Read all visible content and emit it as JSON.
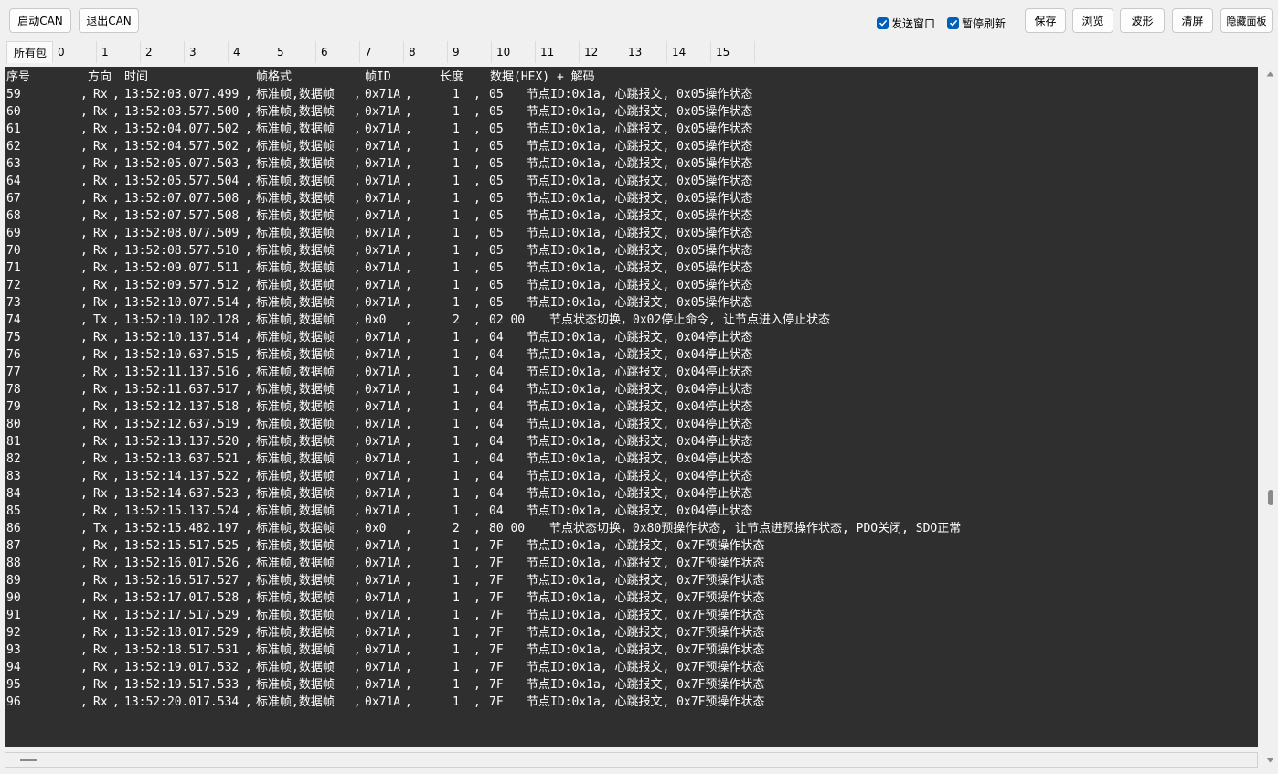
{
  "toolbar": {
    "start_can": "启动CAN",
    "exit_can": "退出CAN",
    "send_window": "发送窗口",
    "pause_refresh": "暂停刷新",
    "save": "保存",
    "browse": "浏览",
    "waveform": "波形",
    "clear": "清屏",
    "hide_panel": "隐藏面板"
  },
  "tabs": [
    "所有包",
    "0",
    "1",
    "2",
    "3",
    "4",
    "5",
    "6",
    "7",
    "8",
    "9",
    "10",
    "11",
    "12",
    "13",
    "14",
    "15"
  ],
  "console": {
    "header": {
      "seq": "序号",
      "dir": "方向",
      "time": "时间",
      "format": "帧格式",
      "id": "帧ID",
      "len": "长度",
      "data": "数据(HEX) + 解码"
    },
    "rows": [
      {
        "seq": "59",
        "dir": "Rx",
        "time": "13:52:03.077.499",
        "format": "标准帧,数据帧",
        "id": "0x71A",
        "len": "1",
        "data": "05",
        "decode": "节点ID:0x1a, 心跳报文, 0x05操作状态"
      },
      {
        "seq": "60",
        "dir": "Rx",
        "time": "13:52:03.577.500",
        "format": "标准帧,数据帧",
        "id": "0x71A",
        "len": "1",
        "data": "05",
        "decode": "节点ID:0x1a, 心跳报文, 0x05操作状态"
      },
      {
        "seq": "61",
        "dir": "Rx",
        "time": "13:52:04.077.502",
        "format": "标准帧,数据帧",
        "id": "0x71A",
        "len": "1",
        "data": "05",
        "decode": "节点ID:0x1a, 心跳报文, 0x05操作状态"
      },
      {
        "seq": "62",
        "dir": "Rx",
        "time": "13:52:04.577.502",
        "format": "标准帧,数据帧",
        "id": "0x71A",
        "len": "1",
        "data": "05",
        "decode": "节点ID:0x1a, 心跳报文, 0x05操作状态"
      },
      {
        "seq": "63",
        "dir": "Rx",
        "time": "13:52:05.077.503",
        "format": "标准帧,数据帧",
        "id": "0x71A",
        "len": "1",
        "data": "05",
        "decode": "节点ID:0x1a, 心跳报文, 0x05操作状态"
      },
      {
        "seq": "64",
        "dir": "Rx",
        "time": "13:52:05.577.504",
        "format": "标准帧,数据帧",
        "id": "0x71A",
        "len": "1",
        "data": "05",
        "decode": "节点ID:0x1a, 心跳报文, 0x05操作状态"
      },
      {
        "seq": "67",
        "dir": "Rx",
        "time": "13:52:07.077.508",
        "format": "标准帧,数据帧",
        "id": "0x71A",
        "len": "1",
        "data": "05",
        "decode": "节点ID:0x1a, 心跳报文, 0x05操作状态"
      },
      {
        "seq": "68",
        "dir": "Rx",
        "time": "13:52:07.577.508",
        "format": "标准帧,数据帧",
        "id": "0x71A",
        "len": "1",
        "data": "05",
        "decode": "节点ID:0x1a, 心跳报文, 0x05操作状态"
      },
      {
        "seq": "69",
        "dir": "Rx",
        "time": "13:52:08.077.509",
        "format": "标准帧,数据帧",
        "id": "0x71A",
        "len": "1",
        "data": "05",
        "decode": "节点ID:0x1a, 心跳报文, 0x05操作状态"
      },
      {
        "seq": "70",
        "dir": "Rx",
        "time": "13:52:08.577.510",
        "format": "标准帧,数据帧",
        "id": "0x71A",
        "len": "1",
        "data": "05",
        "decode": "节点ID:0x1a, 心跳报文, 0x05操作状态"
      },
      {
        "seq": "71",
        "dir": "Rx",
        "time": "13:52:09.077.511",
        "format": "标准帧,数据帧",
        "id": "0x71A",
        "len": "1",
        "data": "05",
        "decode": "节点ID:0x1a, 心跳报文, 0x05操作状态"
      },
      {
        "seq": "72",
        "dir": "Rx",
        "time": "13:52:09.577.512",
        "format": "标准帧,数据帧",
        "id": "0x71A",
        "len": "1",
        "data": "05",
        "decode": "节点ID:0x1a, 心跳报文, 0x05操作状态"
      },
      {
        "seq": "73",
        "dir": "Rx",
        "time": "13:52:10.077.514",
        "format": "标准帧,数据帧",
        "id": "0x71A",
        "len": "1",
        "data": "05",
        "decode": "节点ID:0x1a, 心跳报文, 0x05操作状态"
      },
      {
        "seq": "74",
        "dir": "Tx",
        "time": "13:52:10.102.128",
        "format": "标准帧,数据帧",
        "id": "0x0",
        "len": "2",
        "data": "02 00",
        "decode": "节点状态切换，0x02停止命令, 让节点进入停止状态"
      },
      {
        "seq": "75",
        "dir": "Rx",
        "time": "13:52:10.137.514",
        "format": "标准帧,数据帧",
        "id": "0x71A",
        "len": "1",
        "data": "04",
        "decode": "节点ID:0x1a, 心跳报文, 0x04停止状态"
      },
      {
        "seq": "76",
        "dir": "Rx",
        "time": "13:52:10.637.515",
        "format": "标准帧,数据帧",
        "id": "0x71A",
        "len": "1",
        "data": "04",
        "decode": "节点ID:0x1a, 心跳报文, 0x04停止状态"
      },
      {
        "seq": "77",
        "dir": "Rx",
        "time": "13:52:11.137.516",
        "format": "标准帧,数据帧",
        "id": "0x71A",
        "len": "1",
        "data": "04",
        "decode": "节点ID:0x1a, 心跳报文, 0x04停止状态"
      },
      {
        "seq": "78",
        "dir": "Rx",
        "time": "13:52:11.637.517",
        "format": "标准帧,数据帧",
        "id": "0x71A",
        "len": "1",
        "data": "04",
        "decode": "节点ID:0x1a, 心跳报文, 0x04停止状态"
      },
      {
        "seq": "79",
        "dir": "Rx",
        "time": "13:52:12.137.518",
        "format": "标准帧,数据帧",
        "id": "0x71A",
        "len": "1",
        "data": "04",
        "decode": "节点ID:0x1a, 心跳报文, 0x04停止状态"
      },
      {
        "seq": "80",
        "dir": "Rx",
        "time": "13:52:12.637.519",
        "format": "标准帧,数据帧",
        "id": "0x71A",
        "len": "1",
        "data": "04",
        "decode": "节点ID:0x1a, 心跳报文, 0x04停止状态"
      },
      {
        "seq": "81",
        "dir": "Rx",
        "time": "13:52:13.137.520",
        "format": "标准帧,数据帧",
        "id": "0x71A",
        "len": "1",
        "data": "04",
        "decode": "节点ID:0x1a, 心跳报文, 0x04停止状态"
      },
      {
        "seq": "82",
        "dir": "Rx",
        "time": "13:52:13.637.521",
        "format": "标准帧,数据帧",
        "id": "0x71A",
        "len": "1",
        "data": "04",
        "decode": "节点ID:0x1a, 心跳报文, 0x04停止状态"
      },
      {
        "seq": "83",
        "dir": "Rx",
        "time": "13:52:14.137.522",
        "format": "标准帧,数据帧",
        "id": "0x71A",
        "len": "1",
        "data": "04",
        "decode": "节点ID:0x1a, 心跳报文, 0x04停止状态"
      },
      {
        "seq": "84",
        "dir": "Rx",
        "time": "13:52:14.637.523",
        "format": "标准帧,数据帧",
        "id": "0x71A",
        "len": "1",
        "data": "04",
        "decode": "节点ID:0x1a, 心跳报文, 0x04停止状态"
      },
      {
        "seq": "85",
        "dir": "Rx",
        "time": "13:52:15.137.524",
        "format": "标准帧,数据帧",
        "id": "0x71A",
        "len": "1",
        "data": "04",
        "decode": "节点ID:0x1a, 心跳报文, 0x04停止状态"
      },
      {
        "seq": "86",
        "dir": "Tx",
        "time": "13:52:15.482.197",
        "format": "标准帧,数据帧",
        "id": "0x0",
        "len": "2",
        "data": "80 00",
        "decode": "节点状态切换，0x80预操作状态, 让节点进预操作状态, PDO关闭, SDO正常"
      },
      {
        "seq": "87",
        "dir": "Rx",
        "time": "13:52:15.517.525",
        "format": "标准帧,数据帧",
        "id": "0x71A",
        "len": "1",
        "data": "7F",
        "decode": "节点ID:0x1a, 心跳报文, 0x7F预操作状态"
      },
      {
        "seq": "88",
        "dir": "Rx",
        "time": "13:52:16.017.526",
        "format": "标准帧,数据帧",
        "id": "0x71A",
        "len": "1",
        "data": "7F",
        "decode": "节点ID:0x1a, 心跳报文, 0x7F预操作状态"
      },
      {
        "seq": "89",
        "dir": "Rx",
        "time": "13:52:16.517.527",
        "format": "标准帧,数据帧",
        "id": "0x71A",
        "len": "1",
        "data": "7F",
        "decode": "节点ID:0x1a, 心跳报文, 0x7F预操作状态"
      },
      {
        "seq": "90",
        "dir": "Rx",
        "time": "13:52:17.017.528",
        "format": "标准帧,数据帧",
        "id": "0x71A",
        "len": "1",
        "data": "7F",
        "decode": "节点ID:0x1a, 心跳报文, 0x7F预操作状态"
      },
      {
        "seq": "91",
        "dir": "Rx",
        "time": "13:52:17.517.529",
        "format": "标准帧,数据帧",
        "id": "0x71A",
        "len": "1",
        "data": "7F",
        "decode": "节点ID:0x1a, 心跳报文, 0x7F预操作状态"
      },
      {
        "seq": "92",
        "dir": "Rx",
        "time": "13:52:18.017.529",
        "format": "标准帧,数据帧",
        "id": "0x71A",
        "len": "1",
        "data": "7F",
        "decode": "节点ID:0x1a, 心跳报文, 0x7F预操作状态"
      },
      {
        "seq": "93",
        "dir": "Rx",
        "time": "13:52:18.517.531",
        "format": "标准帧,数据帧",
        "id": "0x71A",
        "len": "1",
        "data": "7F",
        "decode": "节点ID:0x1a, 心跳报文, 0x7F预操作状态"
      },
      {
        "seq": "94",
        "dir": "Rx",
        "time": "13:52:19.017.532",
        "format": "标准帧,数据帧",
        "id": "0x71A",
        "len": "1",
        "data": "7F",
        "decode": "节点ID:0x1a, 心跳报文, 0x7F预操作状态"
      },
      {
        "seq": "95",
        "dir": "Rx",
        "time": "13:52:19.517.533",
        "format": "标准帧,数据帧",
        "id": "0x71A",
        "len": "1",
        "data": "7F",
        "decode": "节点ID:0x1a, 心跳报文, 0x7F预操作状态"
      },
      {
        "seq": "96",
        "dir": "Rx",
        "time": "13:52:20.017.534",
        "format": "标准帧,数据帧",
        "id": "0x71A",
        "len": "1",
        "data": "7F",
        "decode": "节点ID:0x1a, 心跳报文, 0x7F预操作状态"
      }
    ]
  },
  "colors": {
    "console_bg": "#2f2f2f",
    "console_text": "#ffffff",
    "checkbox_accent": "#005fb8"
  },
  "icons": {
    "scroll_up": "chevron-up-icon",
    "scroll_down": "chevron-down-icon",
    "check": "check-icon"
  }
}
